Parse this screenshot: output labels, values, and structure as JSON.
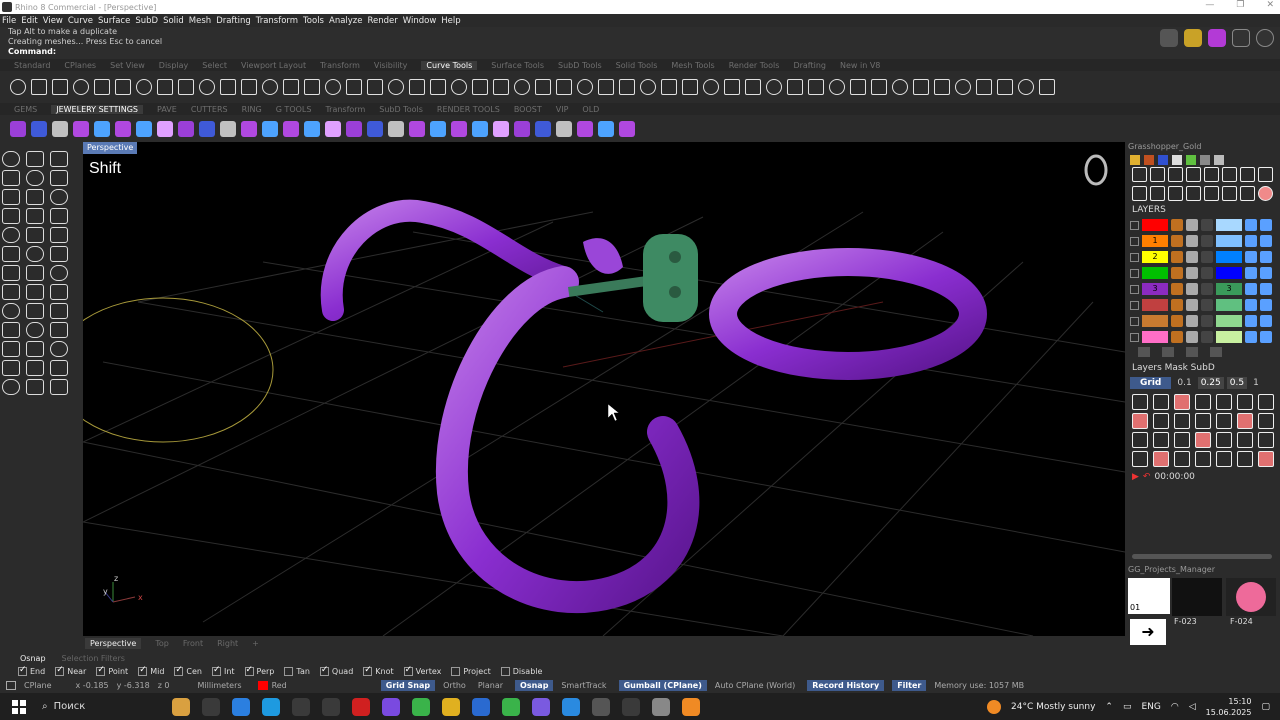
{
  "window": {
    "title": "Rhino 8 Commercial - [Perspective]",
    "controls": [
      "—",
      "❐",
      "✕"
    ]
  },
  "menu": [
    "File",
    "Edit",
    "View",
    "Curve",
    "Surface",
    "SubD",
    "Solid",
    "Mesh",
    "Drafting",
    "Transform",
    "Tools",
    "Analyze",
    "Render",
    "Window",
    "Help"
  ],
  "command": {
    "history1": "Tap Alt to make a duplicate",
    "history2": "Creating meshes... Press Esc to cancel",
    "prompt": "Command:"
  },
  "toolbar_tabs1": [
    "Standard",
    "CPlanes",
    "Set View",
    "Display",
    "Select",
    "Viewport Layout",
    "Transform",
    "Visibility",
    "Curve Tools",
    "Surface Tools",
    "SubD Tools",
    "Solid Tools",
    "Mesh Tools",
    "Render Tools",
    "Drafting",
    "New in V8"
  ],
  "toolbar_tabs1_active": "Curve Tools",
  "toolbar_tabs2": [
    "GEMS",
    "JEWELERY SETTINGS",
    "PAVE",
    "CUTTERS",
    "RING",
    "G TOOLS",
    "Transform",
    "SubD Tools",
    "RENDER TOOLS",
    "BOOST",
    "VIP",
    "OLD"
  ],
  "toolbar_tabs2_active": "JEWELERY SETTINGS",
  "viewport": {
    "label": "Perspective",
    "overlay_text": "Shift",
    "axis_z": "z",
    "axis_y": "y",
    "axis_x": "x"
  },
  "viewport_tabs": [
    "Perspective",
    "Top",
    "Front",
    "Right",
    "+"
  ],
  "right_panel": {
    "grasshopper_header": "Grasshopper_Gold",
    "layers_title": "LAYERS",
    "layers": [
      {
        "label": "",
        "color": "#ff0000"
      },
      {
        "label": "1",
        "color": "#ff7f00"
      },
      {
        "label": "2",
        "color": "#ffff00"
      },
      {
        "label": "",
        "color": "#00c000"
      },
      {
        "label": "3",
        "color": "#8b2bbf"
      },
      {
        "label": "",
        "color": "#c04040"
      },
      {
        "label": "",
        "color": "#c87a30"
      },
      {
        "label": "",
        "color": "#ff6ec7"
      }
    ],
    "layers_right": [
      {
        "label": "",
        "color": "#a8d8ff"
      },
      {
        "label": "",
        "color": "#80c0ff"
      },
      {
        "label": "",
        "color": "#0080ff"
      },
      {
        "label": "",
        "color": "#0000ff"
      },
      {
        "label": "3",
        "color": "#3a9a5a"
      },
      {
        "label": "",
        "color": "#60c080"
      },
      {
        "label": "",
        "color": "#90d890"
      },
      {
        "label": "",
        "color": "#c8f0a0"
      }
    ],
    "mask_title": "Layers Mask SubD",
    "grid_label": "Grid",
    "grid_values": [
      "0.1",
      "0.25",
      "0.5",
      "1"
    ],
    "timer": "00:00:00",
    "projects_header": "GG_Projects_Manager",
    "project_num": "01",
    "thumb_labels": [
      "F-023",
      "F-024"
    ]
  },
  "osnap_tabs": [
    "Osnap",
    "Selection Filters"
  ],
  "osnaps": [
    {
      "label": "End",
      "on": true
    },
    {
      "label": "Near",
      "on": true
    },
    {
      "label": "Point",
      "on": true
    },
    {
      "label": "Mid",
      "on": true
    },
    {
      "label": "Cen",
      "on": true
    },
    {
      "label": "Int",
      "on": true
    },
    {
      "label": "Perp",
      "on": true
    },
    {
      "label": "Tan",
      "on": false
    },
    {
      "label": "Quad",
      "on": true
    },
    {
      "label": "Knot",
      "on": true
    },
    {
      "label": "Vertex",
      "on": true
    },
    {
      "label": "Project",
      "on": false
    },
    {
      "label": "Disable",
      "on": false
    }
  ],
  "status": {
    "cplane": "CPlane",
    "x": "x -0.185",
    "y": "y -6.318",
    "z": "z 0",
    "units": "Millimeters",
    "layer": "Red",
    "grid_snap": "Grid Snap",
    "ortho": "Ortho",
    "planar": "Planar",
    "osnap": "Osnap",
    "smarttrack": "SmartTrack",
    "gumball": "Gumball (CPlane)",
    "autocplane": "Auto CPlane (World)",
    "record": "Record History",
    "filter": "Filter",
    "memory": "Memory use: 1057 MB"
  },
  "taskbar": {
    "search": "Поиск",
    "weather": "24°C  Mostly sunny",
    "lang": "ENG",
    "time": "15:10",
    "date": "15.06.2025"
  }
}
